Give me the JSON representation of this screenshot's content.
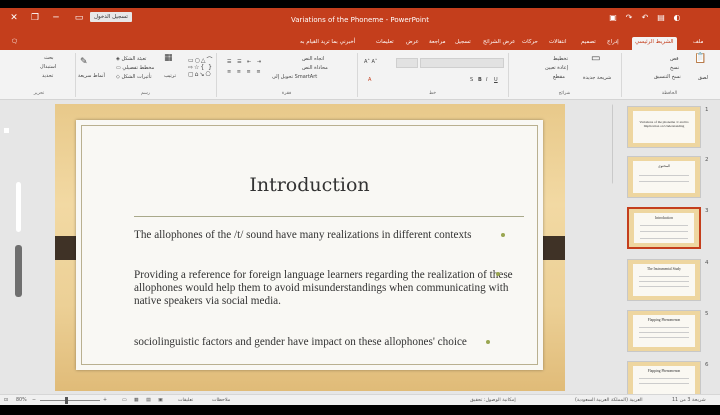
{
  "window": {
    "title": "Variations of the Phoneme - PowerPoint",
    "sign_in": "تسجيل الدخول",
    "close_glyph": "✕",
    "restore_glyph": "❐",
    "minimize_glyph": "─"
  },
  "tabs": [
    "ملف",
    "الشريط الرئيسي",
    "إدراج",
    "تصميم",
    "انتقالات",
    "حركات",
    "عرض الشرائح",
    "تسجيل",
    "مراجعة",
    "عرض",
    "تعليمات"
  ],
  "active_tab": "الشريط الرئيسي",
  "tell_me": "أخبرني بما تريد القيام به",
  "ribbon": {
    "groups": [
      {
        "label": "الحافظة",
        "items": [
          "قص",
          "نسخ",
          "نسخ التنسيق",
          "لصق"
        ]
      },
      {
        "label": "شرائح",
        "items": [
          "تخطيط",
          "إعادة تعيين",
          "مقطع",
          "شريحة جديدة"
        ]
      },
      {
        "label": "خط",
        "items": [
          "B",
          "I",
          "U",
          "S",
          "A"
        ]
      },
      {
        "label": "فقرة",
        "items": [
          "اتجاه النص",
          "محاذاة النص",
          "تحويل إلى SmartArt"
        ]
      },
      {
        "label": "رسم",
        "items": [
          "أشكال",
          "ترتيب",
          "أنماط سريعة"
        ]
      },
      {
        "label": "تحرير",
        "items": [
          "بحث",
          "استبدال",
          "تحديد"
        ]
      }
    ]
  },
  "slide": {
    "title": "Introduction",
    "bullets": [
      "The allophones of the /t/ sound have many realizations in different contexts",
      "Providing a reference for foreign language learners regarding the realization of these allophones would help them to avoid misunderstandings when communicating with native speakers via social media.",
      "sociolinguistic factors and gender have impact on these allophones' choice"
    ]
  },
  "thumbnails": [
    {
      "number": "1",
      "title": "Variations of the phoneme /t/ and its Implication on Understanding"
    },
    {
      "number": "2",
      "title": "المحتوى"
    },
    {
      "number": "3",
      "title": "Introduction"
    },
    {
      "number": "4",
      "title": "The Instrumental Study"
    },
    {
      "number": "5",
      "title": "Flapping Phenomenon"
    },
    {
      "number": "6",
      "title": "Flapping Phenomenon"
    }
  ],
  "selected_slide": "3",
  "status": {
    "slide_counter": "شريحة 3 من 11",
    "language": "العربية (المملكة العربية السعودية)",
    "accessibility": "إمكانية الوصول: تحقيق",
    "notes": "ملاحظات",
    "comments": "تعليقات",
    "zoom": "80%"
  },
  "colors": {
    "accent": "#c43e1c",
    "slide_bg_wood": "#ecd096",
    "bullet": "#9aa650"
  }
}
